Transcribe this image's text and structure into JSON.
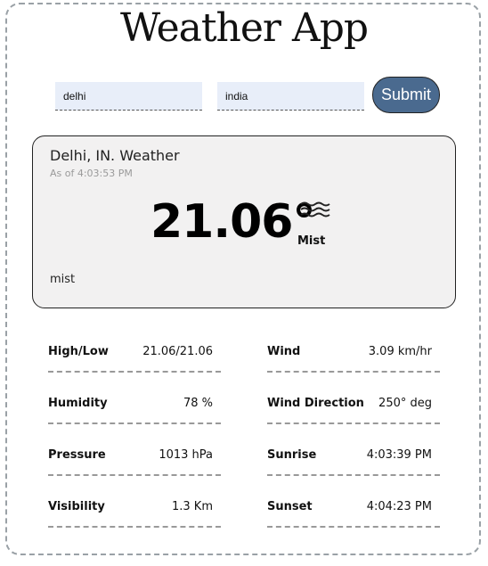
{
  "app": {
    "title": "Weather App"
  },
  "form": {
    "city_value": "delhi",
    "country_value": "india",
    "submit_label": "Submit"
  },
  "current": {
    "location": "Delhi, IN. Weather",
    "as_of": "As of 4:03:53 PM",
    "temperature": "21.06°",
    "condition_label": "Mist",
    "description": "mist",
    "icon": "mist-icon"
  },
  "details": [
    {
      "label": "High/Low",
      "value": "21.06/21.06"
    },
    {
      "label": "Wind",
      "value": "3.09 km/hr"
    },
    {
      "label": "Humidity",
      "value": "78 %"
    },
    {
      "label": "Wind Direction",
      "value": "250° deg"
    },
    {
      "label": "Pressure",
      "value": "1013 hPa"
    },
    {
      "label": "Sunrise",
      "value": "4:03:39 PM"
    },
    {
      "label": "Visibility",
      "value": "1.3 Km"
    },
    {
      "label": "Sunset",
      "value": "4:04:23 PM"
    }
  ]
}
